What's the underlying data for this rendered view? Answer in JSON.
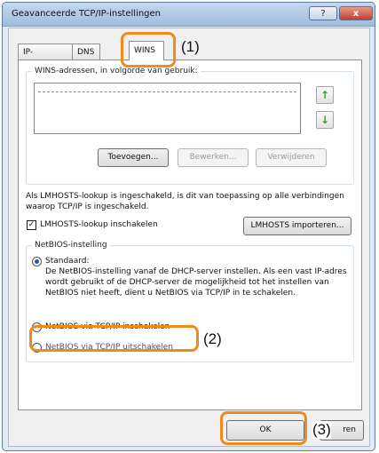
{
  "window": {
    "title": "Geavanceerde TCP/IP-instellingen",
    "help_label": "?",
    "close_label": "x"
  },
  "tabs": [
    {
      "label": "IP-instellingen"
    },
    {
      "label": "DNS"
    },
    {
      "label": "WINS",
      "selected": true
    }
  ],
  "wins": {
    "group_label": "WINS-adressen, in volgorde van gebruik:",
    "move_up_icon": "↑",
    "move_down_icon": "↓",
    "add_label": "Toevoegen...",
    "edit_label": "Bewerken...",
    "remove_label": "Verwijderen"
  },
  "lmhosts": {
    "description": "Als LMHOSTS-lookup is ingeschakeld, is dit van toepassing op alle verbindingen waarop TCP/IP is ingeschakeld.",
    "checkbox_label": "LMHOSTS-lookup inschakelen",
    "checkbox_mark": "✓",
    "import_label": "LMHOSTS importeren..."
  },
  "netbios": {
    "group_label": "NetBIOS-instelling",
    "default_label": "Standaard:",
    "default_description": "De NetBIOS-instelling vanaf de DHCP-server instellen. Als een vast IP-adres wordt gebruikt of de DHCP-server de mogelijkheid tot het instellen van NetBIOS niet heeft, dient u NetBIOS via TCP/IP in te schakelen.",
    "enable_label": "NetBIOS via TCP/IP inschakelen",
    "disable_label": "NetBIOS via TCP/IP uitschakelen"
  },
  "footer": {
    "ok_label": "OK",
    "cancel_label_visible": "ren"
  },
  "annotations": {
    "step1": "(1)",
    "step2": "(2)",
    "step3": "(3)"
  },
  "colors": {
    "highlight": "#f08a1c",
    "arrow_green": "#3a9c3a"
  }
}
